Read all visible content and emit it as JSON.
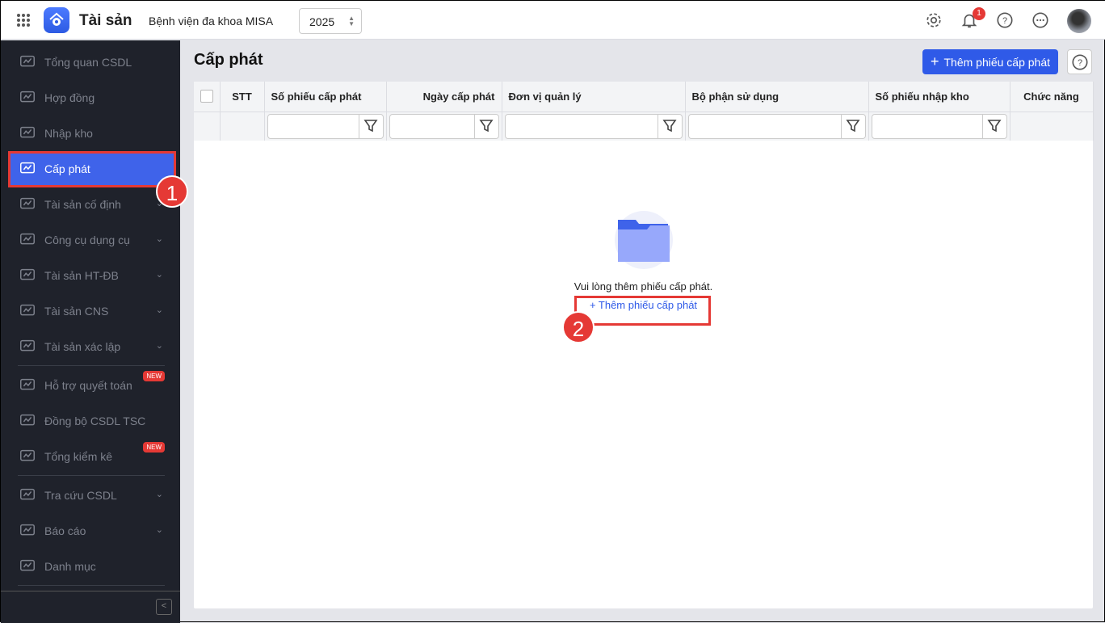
{
  "header": {
    "app_name": "Tài sản",
    "organization": "Bệnh viện đa khoa MISA",
    "year": "2025",
    "notification_count": "1"
  },
  "sidebar": {
    "items": [
      {
        "label": "Tổng quan CSDL"
      },
      {
        "label": "Hợp đồng"
      },
      {
        "label": "Nhập kho"
      },
      {
        "label": "Cấp phát"
      },
      {
        "label": "Tài sản cố định"
      },
      {
        "label": "Công cụ dụng cụ"
      },
      {
        "label": "Tài sản HT-ĐB"
      },
      {
        "label": "Tài sản CNS"
      },
      {
        "label": "Tài sản xác lập"
      },
      {
        "label": "Hỗ trợ quyết toán",
        "badge": "NEW"
      },
      {
        "label": "Đồng bộ CSDL TSC"
      },
      {
        "label": "Tổng kiểm kê",
        "badge": "NEW"
      },
      {
        "label": "Tra cứu CSDL"
      },
      {
        "label": "Báo cáo"
      },
      {
        "label": "Danh mục"
      }
    ]
  },
  "page": {
    "title": "Cấp phát",
    "add_button": "Thêm phiếu cấp phát"
  },
  "table": {
    "columns": [
      "STT",
      "Số phiếu cấp phát",
      "Ngày cấp phát",
      "Đơn vị quản lý",
      "Bộ phận sử dụng",
      "Số phiếu nhập kho",
      "Chức năng"
    ]
  },
  "empty": {
    "message": "Vui lòng thêm phiếu cấp phát.",
    "link": "Thêm phiếu cấp phát"
  },
  "annotations": [
    "1",
    "2"
  ],
  "colors": {
    "accent": "#2f5ae8",
    "sidebar": "#1f222b",
    "annotation": "#e53935"
  }
}
